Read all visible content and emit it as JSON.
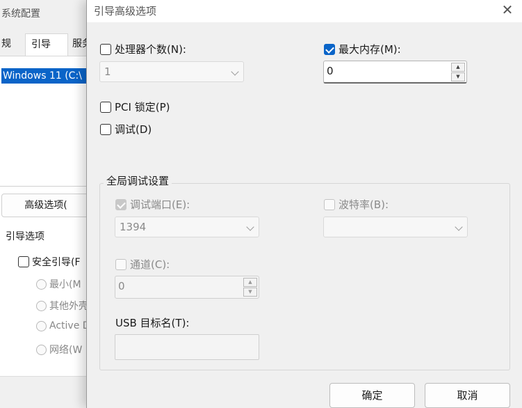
{
  "background_window": {
    "title": "系统配置",
    "tabs": [
      "规",
      "引导",
      "服务"
    ],
    "os_entry": "Windows 11 (C:\\",
    "advanced_button": "高级选项(",
    "boot_options_label": "引导选项",
    "safe_boot_label": "安全引导(F",
    "radio_options": [
      "最小(M",
      "其他外壳",
      "Active D",
      "网络(W"
    ]
  },
  "dialog": {
    "title": "引导高级选项",
    "close_glyph": "✕",
    "num_processors": {
      "label": "处理器个数(N):",
      "checked": false,
      "value": "1"
    },
    "max_memory": {
      "label": "最大内存(M):",
      "checked": true,
      "value": "0"
    },
    "pci_lock": {
      "label": "PCI 锁定(P)",
      "checked": false
    },
    "debug": {
      "label": "调试(D)",
      "checked": false
    },
    "global_debug": {
      "group_label": "全局调试设置",
      "debug_port": {
        "label": "调试端口(E):",
        "checked": true,
        "disabled": true,
        "value": "1394"
      },
      "baud_rate": {
        "label": "波特率(B):",
        "checked": false,
        "disabled": true,
        "value": ""
      },
      "channel": {
        "label": "通道(C):",
        "checked": false,
        "disabled": true,
        "value": "0"
      },
      "usb_target": {
        "label": "USB 目标名(T):",
        "value": ""
      }
    },
    "buttons": {
      "ok": "确定",
      "cancel": "取消"
    }
  },
  "colors": {
    "accent": "#0a64c8",
    "disabled_text": "#8a8a8a"
  },
  "icons": {
    "spin_up": "▲",
    "spin_down": "▼"
  }
}
